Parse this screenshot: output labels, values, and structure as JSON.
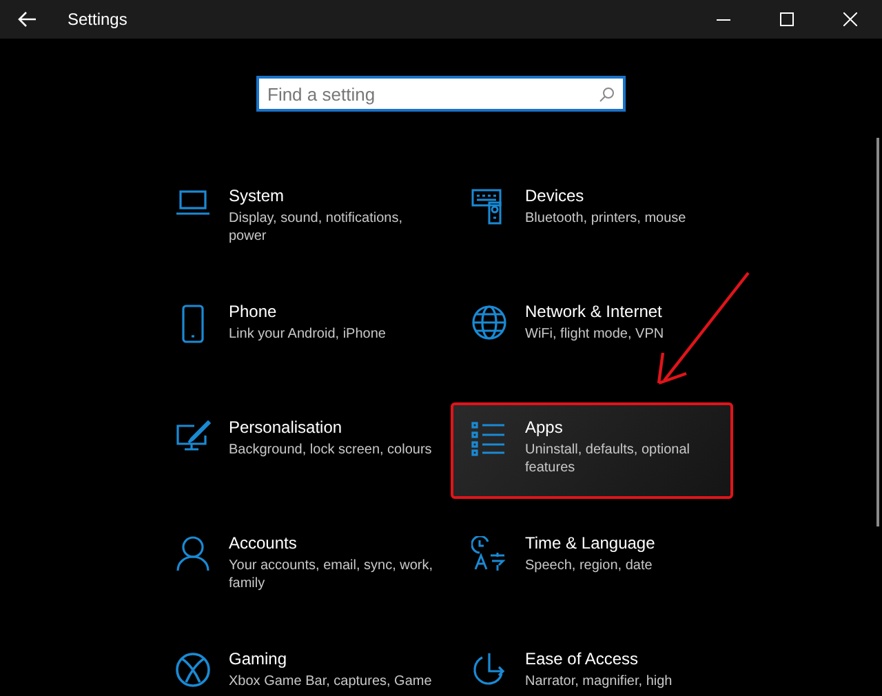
{
  "window": {
    "title": "Settings"
  },
  "search": {
    "placeholder": "Find a setting"
  },
  "tiles": [
    {
      "title": "System",
      "description": "Display, sound, notifications, power",
      "highlighted": false
    },
    {
      "title": "Devices",
      "description": "Bluetooth, printers, mouse",
      "highlighted": false
    },
    {
      "title": "Phone",
      "description": "Link your Android, iPhone",
      "highlighted": false
    },
    {
      "title": "Network & Internet",
      "description": "WiFi, flight mode, VPN",
      "highlighted": false
    },
    {
      "title": "Personalisation",
      "description": "Background, lock screen, colours",
      "highlighted": false
    },
    {
      "title": "Apps",
      "description": "Uninstall, defaults, optional features",
      "highlighted": true
    },
    {
      "title": "Accounts",
      "description": "Your accounts, email, sync, work, family",
      "highlighted": false
    },
    {
      "title": "Time & Language",
      "description": "Speech, region, date",
      "highlighted": false
    },
    {
      "title": "Gaming",
      "description": "Xbox Game Bar, captures, Game",
      "highlighted": false
    },
    {
      "title": "Ease of Access",
      "description": "Narrator, magnifier, high",
      "highlighted": false
    }
  ]
}
